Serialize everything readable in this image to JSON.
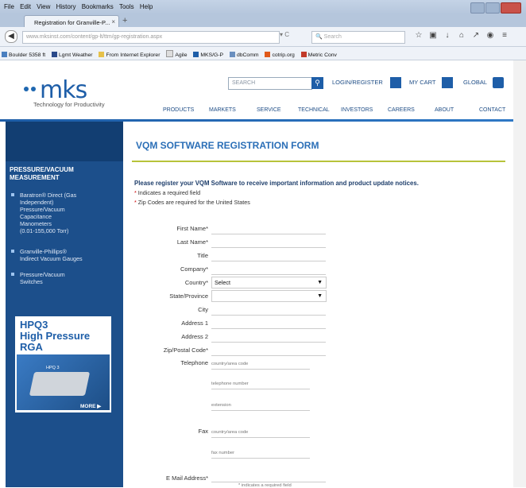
{
  "browser": {
    "menu": [
      "File",
      "Edit",
      "View",
      "History",
      "Bookmarks",
      "Tools",
      "Help"
    ],
    "tab_title": "Registration for Granville-P...",
    "url": "www.mksinst.com/content/gp-lt/ttm/gp-registration.aspx",
    "url_domain": "mksinst",
    "search_placeholder": "Search",
    "bookmarks": [
      "Boulder 5358 ft",
      "Lgmt Weather",
      "From Internet Explorer",
      "Agile",
      "MKS/G-P",
      "dbComm",
      "cotrip.org",
      "Metric Conv"
    ]
  },
  "header": {
    "logo_text": "mks",
    "tagline": "Technology for Productivity",
    "search_placeholder": "SEARCH",
    "login": "LOGIN/REGISTER",
    "cart": "MY CART",
    "global": "GLOBAL"
  },
  "nav": [
    "PRODUCTS",
    "MARKETS",
    "SERVICE",
    "TECHNICAL",
    "INVESTORS",
    "CAREERS",
    "ABOUT",
    "CONTACT"
  ],
  "sidebar": {
    "heading1": "PRESSURE/VACUUM",
    "heading2": "MEASUREMENT",
    "items": [
      [
        "Baratron® Direct (Gas",
        "Independent)",
        "Pressure/Vacuum",
        "Capacitance",
        "Manometers",
        "(0.01-155,000 Torr)"
      ],
      [
        "Granville-Phillips®",
        "Indirect Vacuum Gauges"
      ],
      [
        "Pressure/Vacuum",
        "Switches"
      ]
    ],
    "promo_title": [
      "HPQ3",
      "High Pressure",
      "RGA"
    ],
    "promo_device": "HPQ 3",
    "promo_more": "MORE ▶"
  },
  "form": {
    "title": "VQM SOFTWARE REGISTRATION FORM",
    "intro": "Please register your VQM Software to receive important information and product update notices.",
    "note_required": "Indicates a required field",
    "note_zip": "Zip Codes are required for the United States",
    "labels": {
      "first_name": "First Name*",
      "last_name": "Last Name*",
      "title": "Title",
      "company": "Company*",
      "country": "Country*",
      "state": "State/Province",
      "city": "City",
      "address1": "Address 1",
      "address2": "Address 2",
      "zip": "Zip/Postal Code*",
      "telephone": "Telephone",
      "fax": "Fax",
      "email": "E Mail Address*"
    },
    "country_value": "Select",
    "state_value": "",
    "phone_placeholders": [
      "country/area code",
      "telephone number",
      "extension"
    ],
    "fax_placeholders": [
      "country/area code",
      "fax number"
    ],
    "bottom_hint": "* indicates a required field"
  }
}
